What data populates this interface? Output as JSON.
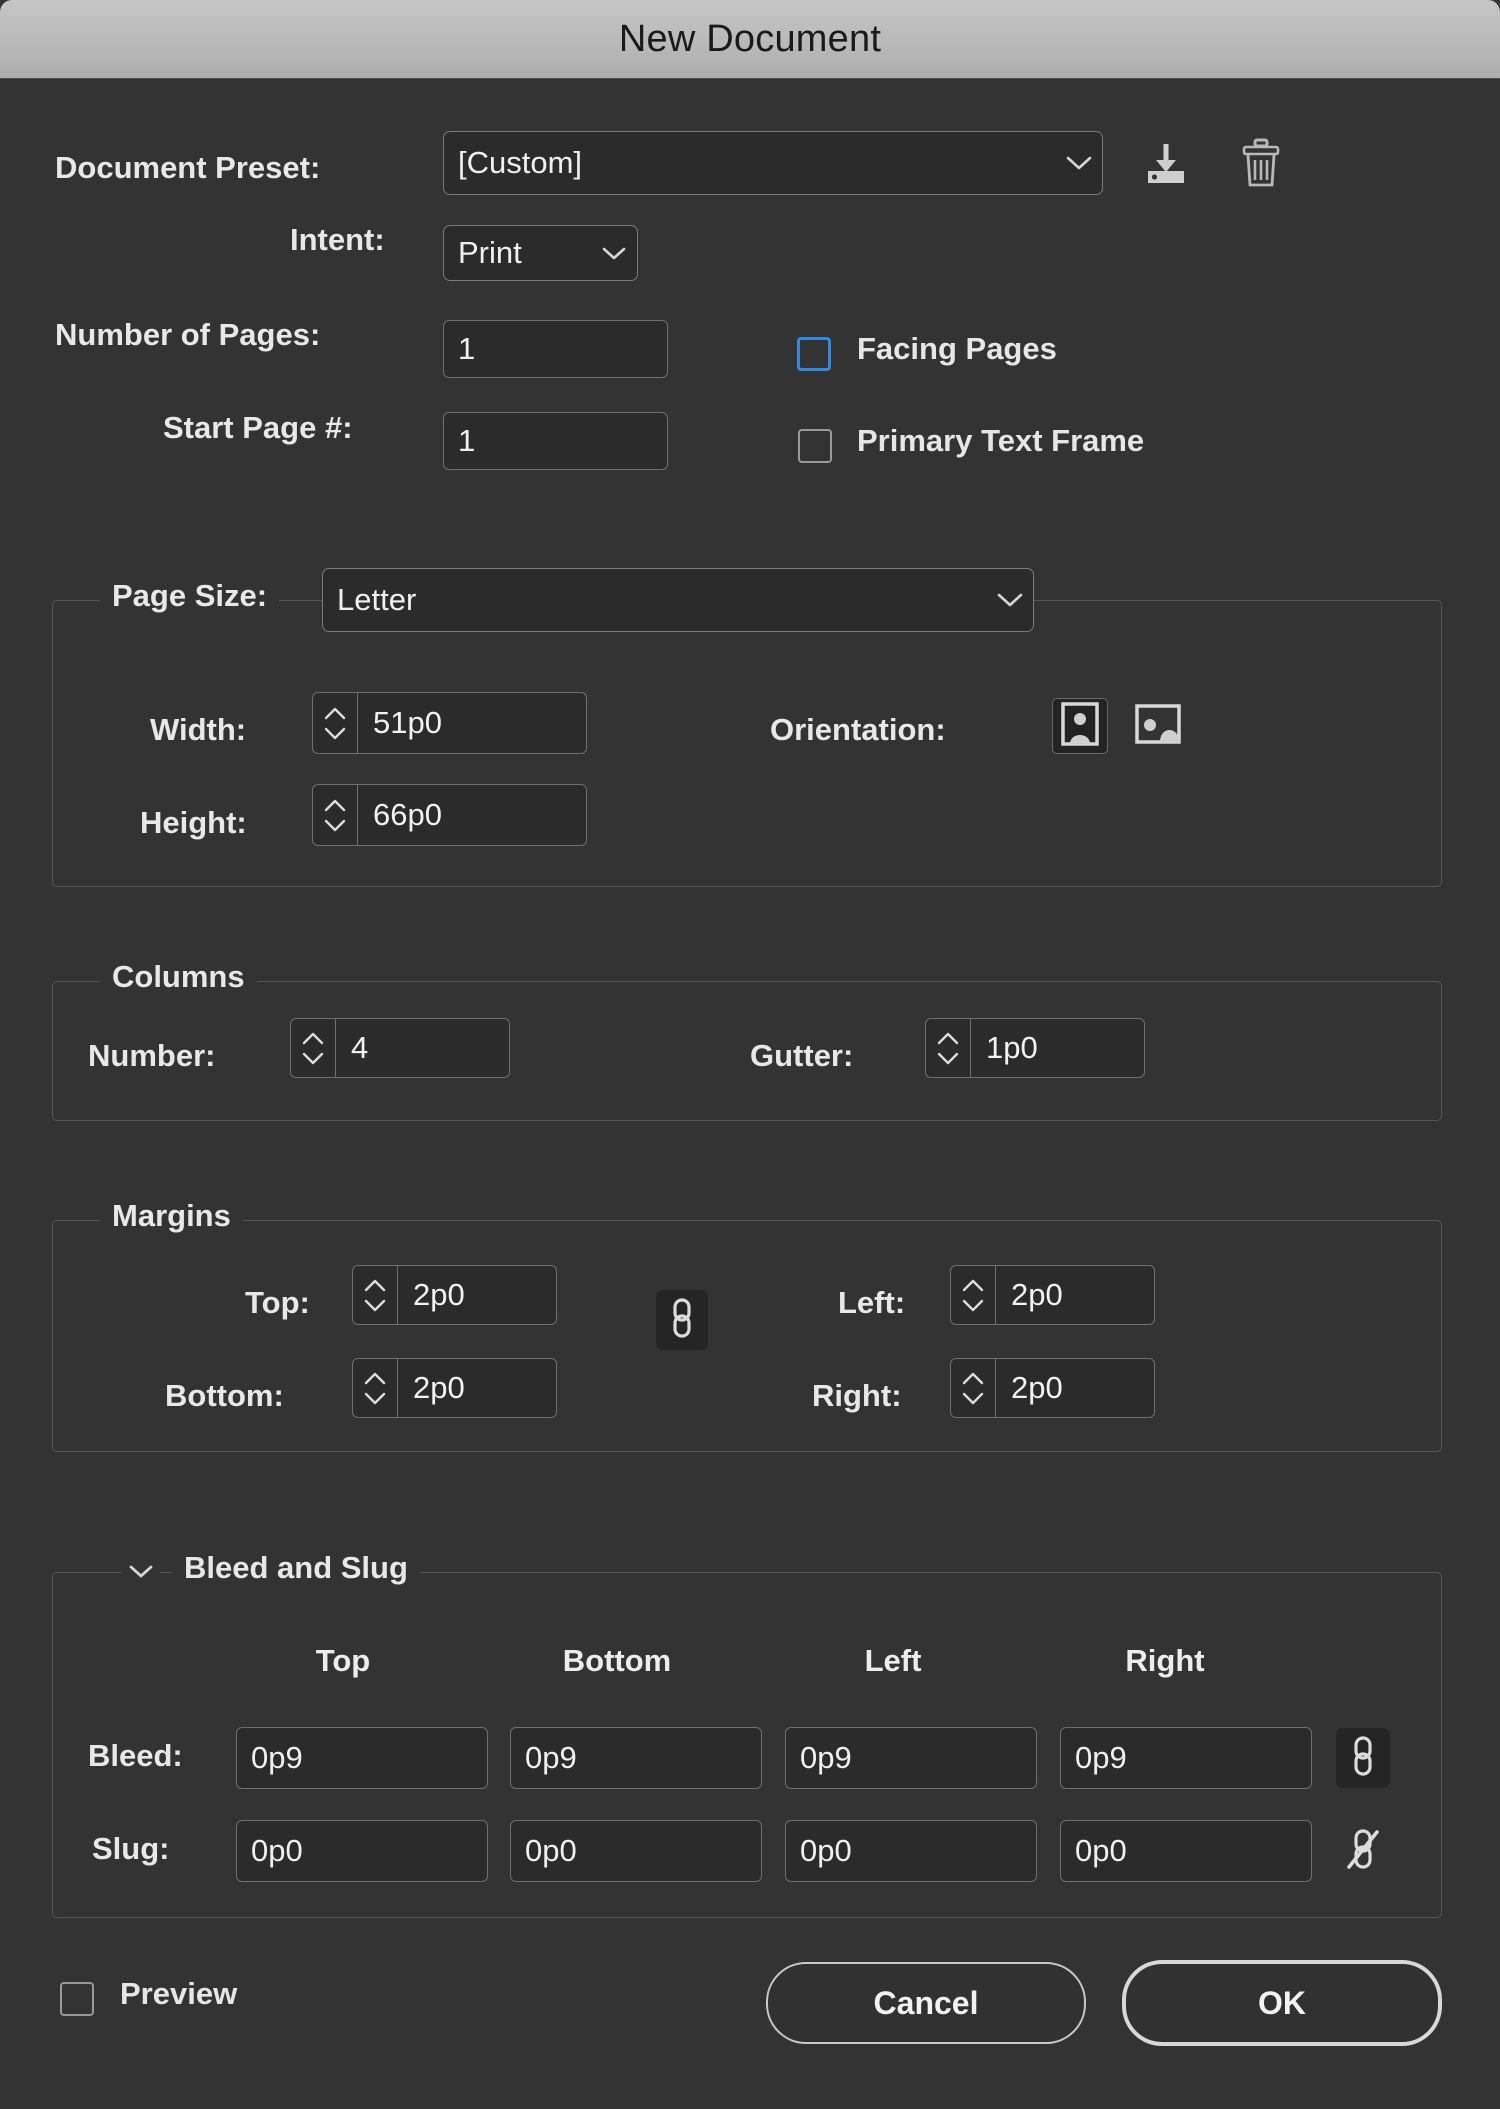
{
  "window": {
    "title": "New Document"
  },
  "preset": {
    "label": "Document Preset:",
    "value": "[Custom]",
    "save_icon": "save-preset-icon",
    "delete_icon": "trash-icon",
    "chevron_icon": "chevron-down-icon"
  },
  "intent": {
    "label": "Intent:",
    "value": "Print"
  },
  "pages": {
    "number_label": "Number of Pages:",
    "number_value": "1",
    "start_label": "Start Page #:",
    "start_value": "1",
    "facing_pages_label": "Facing Pages",
    "facing_pages_checked": false,
    "facing_pages_focus_color": "#2f8ae0",
    "primary_text_frame_label": "Primary Text Frame",
    "primary_text_frame_checked": false
  },
  "page_size": {
    "legend": "Page Size:",
    "value": "Letter",
    "width_label": "Width:",
    "width_value": "51p0",
    "height_label": "Height:",
    "height_value": "66p0",
    "orientation_label": "Orientation:",
    "orientation_selected": "portrait",
    "portrait_icon": "portrait-orientation-icon",
    "landscape_icon": "landscape-orientation-icon"
  },
  "columns": {
    "legend": "Columns",
    "number_label": "Number:",
    "number_value": "4",
    "gutter_label": "Gutter:",
    "gutter_value": "1p0"
  },
  "margins": {
    "legend": "Margins",
    "top_label": "Top:",
    "top_value": "2p0",
    "bottom_label": "Bottom:",
    "bottom_value": "2p0",
    "left_label": "Left:",
    "left_value": "2p0",
    "right_label": "Right:",
    "right_value": "2p0",
    "link_icon": "chain-link-icon",
    "link_active": true
  },
  "bleed_slug": {
    "legend": "Bleed and Slug",
    "expanded": true,
    "disclosure_icon": "chevron-down-icon",
    "columns": [
      "Top",
      "Bottom",
      "Left",
      "Right"
    ],
    "rows": [
      {
        "label": "Bleed:",
        "values": [
          "0p9",
          "0p9",
          "0p9",
          "0p9"
        ],
        "link_icon": "chain-link-icon",
        "link_active": true
      },
      {
        "label": "Slug:",
        "values": [
          "0p0",
          "0p0",
          "0p0",
          "0p0"
        ],
        "link_icon": "chain-link-broken-icon",
        "link_active": false
      }
    ]
  },
  "footer": {
    "preview_label": "Preview",
    "preview_checked": false,
    "cancel_label": "Cancel",
    "ok_label": "OK"
  }
}
